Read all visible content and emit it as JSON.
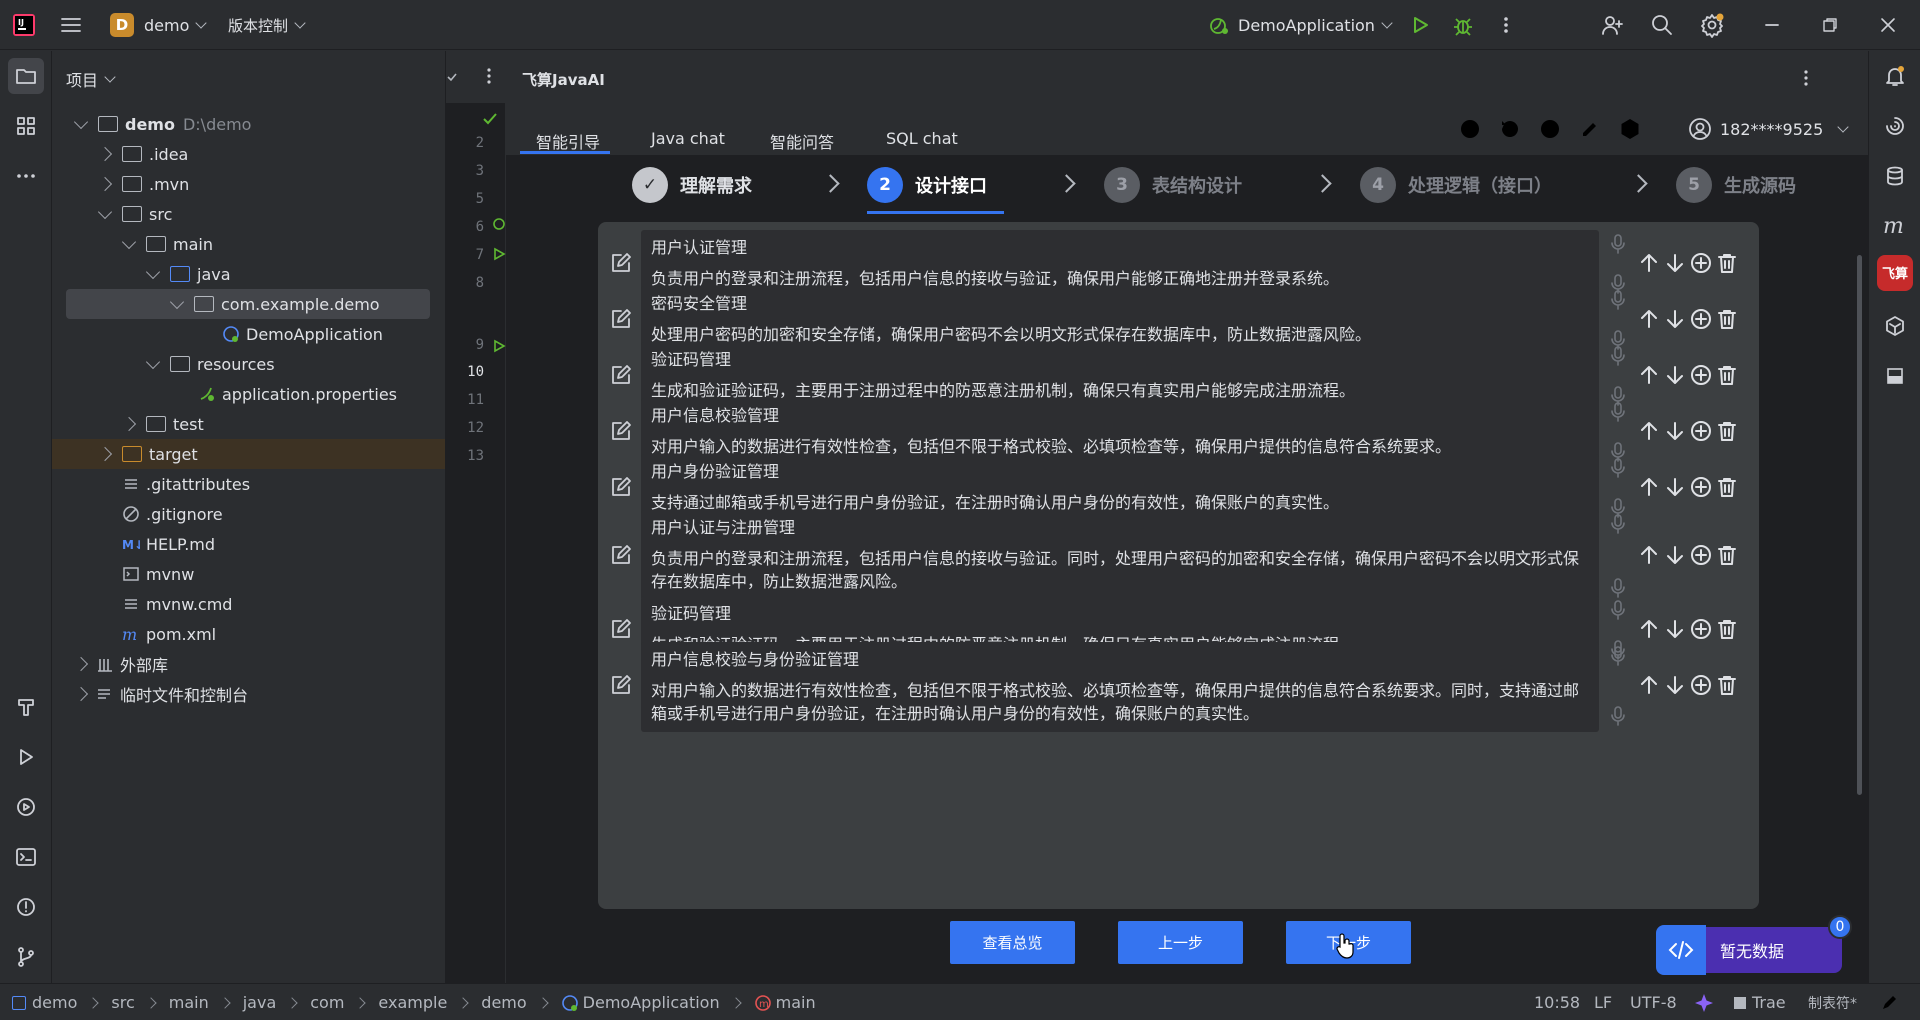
{
  "titlebar": {
    "project_initial": "D",
    "project_name": "demo",
    "vcs_label": "版本控制",
    "run_config": "DemoApplication"
  },
  "project_panel": {
    "header": "项目",
    "tree": [
      {
        "label": "demo",
        "hint": "D:\\demo"
      },
      {
        "label": ".idea"
      },
      {
        "label": ".mvn"
      },
      {
        "label": "src"
      },
      {
        "label": "main"
      },
      {
        "label": "java"
      },
      {
        "label": "com.example.demo"
      },
      {
        "label": "DemoApplication"
      },
      {
        "label": "resources"
      },
      {
        "label": "application.properties"
      },
      {
        "label": "test"
      },
      {
        "label": "target"
      },
      {
        "label": ".gitattributes"
      },
      {
        "label": ".gitignore"
      },
      {
        "label": "HELP.md"
      },
      {
        "label": "mvnw"
      },
      {
        "label": "mvnw.cmd"
      },
      {
        "label": "pom.xml"
      },
      {
        "label": "外部库"
      },
      {
        "label": "临时文件和控制台"
      }
    ]
  },
  "gutter": {
    "lines": [
      "2",
      "3",
      "5",
      "6",
      "7",
      "8",
      "9",
      "10",
      "11",
      "12",
      "13"
    ]
  },
  "plugin": {
    "title": "飞算JavaAI",
    "tabs": [
      "智能引导",
      "Java chat",
      "智能问答",
      "SQL chat"
    ],
    "account": "182****9525",
    "steps": [
      {
        "num": "✓",
        "label": "理解需求"
      },
      {
        "num": "2",
        "label": "设计接口"
      },
      {
        "num": "3",
        "label": "表结构设计"
      },
      {
        "num": "4",
        "label": "处理逻辑（接口）"
      },
      {
        "num": "5",
        "label": "生成源码"
      }
    ],
    "items": [
      {
        "title": "用户认证管理",
        "desc": "负责用户的登录和注册流程，包括用户信息的接收与验证，确保用户能够正确地注册并登录系统。"
      },
      {
        "title": "密码安全管理",
        "desc": "处理用户密码的加密和安全存储，确保用户密码不会以明文形式保存在数据库中，防止数据泄露风险。"
      },
      {
        "title": "验证码管理",
        "desc": "生成和验证验证码，主要用于注册过程中的防恶意注册机制，确保只有真实用户能够完成注册流程。"
      },
      {
        "title": "用户信息校验管理",
        "desc": "对用户输入的数据进行有效性检查，包括但不限于格式校验、必填项检查等，确保用户提供的信息符合系统要求。"
      },
      {
        "title": "用户身份验证管理",
        "desc": "支持通过邮箱或手机号进行用户身份验证，在注册时确认用户身份的有效性，确保账户的真实性。"
      },
      {
        "title": "用户认证与注册管理",
        "desc": "负责用户的登录和注册流程，包括用户信息的接收与验证。同时，处理用户密码的加密和安全存储，确保用户密码不会以明文形式保存在数据库中，防止数据泄露风险。"
      },
      {
        "title": "验证码管理",
        "desc": "生成和验证验证码，主要用于注册过程中的防恶意注册机制，确保只有真实用户能够完成注册流程。"
      },
      {
        "title": "用户信息校验与身份验证管理",
        "desc": "对用户输入的数据进行有效性检查，包括但不限于格式校验、必填项检查等，确保用户提供的信息符合系统要求。同时，支持通过邮箱或手机号进行用户身份验证，在注册时确认用户身份的有效性，确保账户的真实性。"
      }
    ],
    "buttons": {
      "overview": "查看总览",
      "prev": "上一步",
      "next": "下一步"
    },
    "widget": {
      "label": "暂无数据",
      "count": "0"
    }
  },
  "statusbar": {
    "crumbs": [
      "demo",
      "src",
      "main",
      "java",
      "com",
      "example",
      "demo",
      "DemoApplication",
      "main"
    ],
    "position": "10:58",
    "line_sep": "LF",
    "encoding": "UTF-8",
    "trae": "Trae",
    "tab_size": "制表符*"
  },
  "colors": {
    "accent": "#3574f0",
    "bg": "#2b2d30",
    "editor_bg": "#1e1f22",
    "selection": "#43454a",
    "excluded": "#3d3223",
    "run": "#5fb832"
  }
}
